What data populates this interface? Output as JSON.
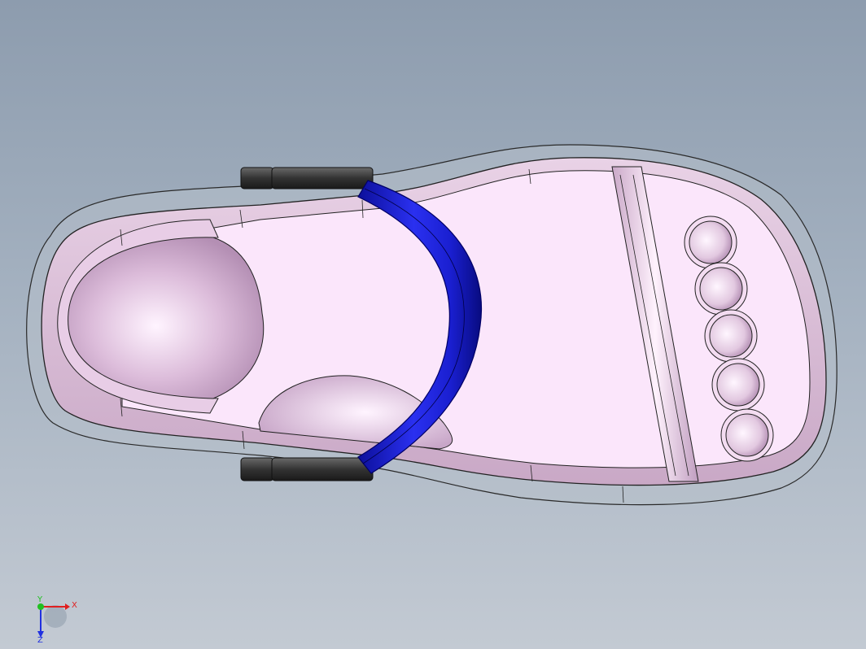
{
  "viewport": {
    "background_top": "#8d9cae",
    "background_bottom": "#c3cad3"
  },
  "model": {
    "sole_color": "#f7e4f4",
    "sole_shade": "#d9b9d6",
    "strap_color": "#1a1fd0",
    "buckle_color": "#3a3a3a",
    "toe_bead_count": 5
  },
  "triad": {
    "x_label": "X",
    "y_label": "Y",
    "z_label": "Z",
    "x_color": "#e02020",
    "y_color": "#20c020",
    "z_color": "#2030e0"
  }
}
